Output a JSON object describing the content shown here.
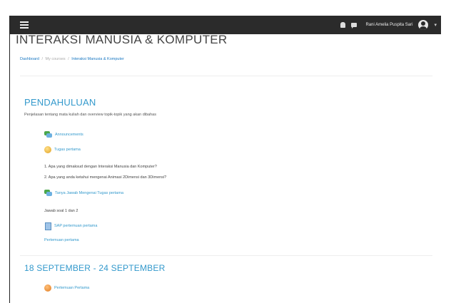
{
  "navbar": {
    "username": "Rani Amelia Puspita Sari"
  },
  "course": {
    "title": "INTERAKSI MANUSIA & KOMPUTER"
  },
  "breadcrumb": [
    "Dashboard",
    "My courses",
    "Interaksi Manusia & Komputer"
  ],
  "sections": [
    {
      "title": "PENDAHULUAN",
      "summary": "Penjelasan tentang mata kuliah dan overview topik-topik yang akan dibahas",
      "activities": [
        {
          "label": "Announcements",
          "icon": "forum-icon"
        },
        {
          "label": "Tugas pertama",
          "icon": "assignment-icon"
        }
      ],
      "questions": [
        "1. Apa yang dimaksud dengan Interaksi Manusia dan Komputer?",
        "2. Apa yang anda ketahui mengenai Animasi 2Dimensi dan 3Dimensi?"
      ],
      "discussion": {
        "label": "Tanya Jawab Mengenai Tugas pertama",
        "icon": "forum-icon"
      },
      "note": "Jawab soal 1 dan 2",
      "file": {
        "label": "SAP pertemuan pertama",
        "icon": "file-icon"
      },
      "link": "Pertemuan pertama"
    },
    {
      "title": "18 SEPTEMBER - 24 SEPTEMBER",
      "activities": [
        {
          "label": "Pertemuan Pertama",
          "icon": "assignment-icon"
        }
      ]
    }
  ]
}
